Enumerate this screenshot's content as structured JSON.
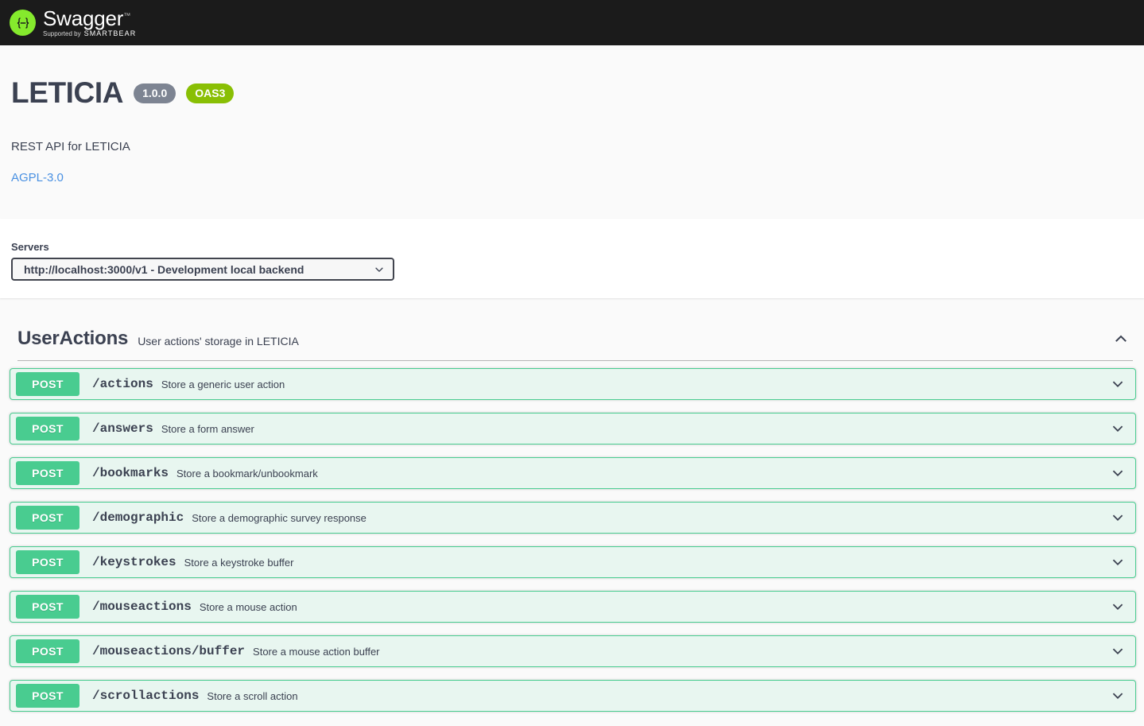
{
  "topbar": {
    "logo_icon": "swagger-braces-icon",
    "logo_word": "Swagger",
    "trademark": "™",
    "supported_by_prefix": "Supported by",
    "supported_by_brand": "SMARTBEAR"
  },
  "info": {
    "title": "LETICIA",
    "version_badge": "1.0.0",
    "spec_badge": "OAS3",
    "description": "REST API for LETICIA",
    "license": "AGPL-3.0"
  },
  "servers": {
    "label": "Servers",
    "selected": "http://localhost:3000/v1 - Development local backend",
    "caret_icon": "chevron-down-icon"
  },
  "tag": {
    "name": "UserActions",
    "description": "User actions' storage in LETICIA",
    "toggle_icon": "chevron-up-icon",
    "expanded": true
  },
  "operations": [
    {
      "method": "POST",
      "path": "/actions",
      "summary": "Store a generic user action",
      "toggle_icon": "chevron-down-icon"
    },
    {
      "method": "POST",
      "path": "/answers",
      "summary": "Store a form answer",
      "toggle_icon": "chevron-down-icon"
    },
    {
      "method": "POST",
      "path": "/bookmarks",
      "summary": "Store a bookmark/unbookmark",
      "toggle_icon": "chevron-down-icon"
    },
    {
      "method": "POST",
      "path": "/demographic",
      "summary": "Store a demographic survey response",
      "toggle_icon": "chevron-down-icon"
    },
    {
      "method": "POST",
      "path": "/keystrokes",
      "summary": "Store a keystroke buffer",
      "toggle_icon": "chevron-down-icon"
    },
    {
      "method": "POST",
      "path": "/mouseactions",
      "summary": "Store a mouse action",
      "toggle_icon": "chevron-down-icon"
    },
    {
      "method": "POST",
      "path": "/mouseactions/buffer",
      "summary": "Store a mouse action buffer",
      "toggle_icon": "chevron-down-icon"
    },
    {
      "method": "POST",
      "path": "/scrollactions",
      "summary": "Store a scroll action",
      "toggle_icon": "chevron-down-icon"
    }
  ],
  "colors": {
    "topbar_bg": "#1b1b1b",
    "logo_green": "#85ea2d",
    "post_green": "#49cc90",
    "post_row_bg": "#e8f6f0",
    "oas_badge": "#89bf04",
    "version_badge": "#7d8492",
    "link_blue": "#4990e2",
    "text_dark": "#3b4151",
    "page_bg": "#fafafa"
  }
}
